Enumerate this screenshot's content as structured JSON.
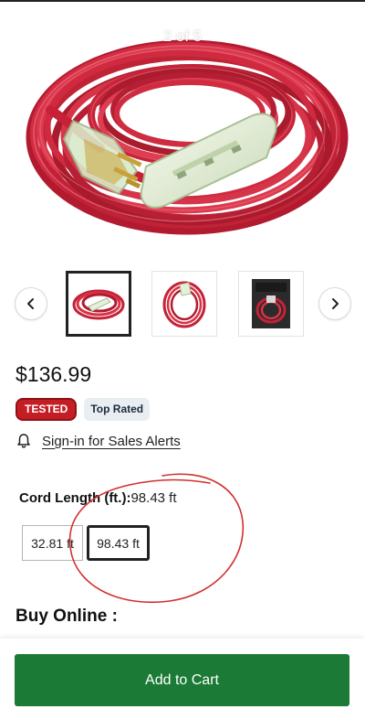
{
  "gallery": {
    "counter": "2 of 5",
    "main_image": "coiled-red-extension-cord-with-lighted-triple-outlet",
    "thumbnails": [
      {
        "name": "coiled-cord-thumbnail",
        "selected": true
      },
      {
        "name": "single-coil-thumbnail",
        "selected": false
      },
      {
        "name": "packaged-cord-thumbnail",
        "selected": false
      }
    ],
    "prev_icon": "chevron-left-icon",
    "next_icon": "chevron-right-icon"
  },
  "product": {
    "price": "$136.99",
    "badges": {
      "tested": "TESTED",
      "top_rated": "Top Rated"
    },
    "sales_alert_icon": "bell-icon",
    "sales_alert_link": "Sign-in for Sales Alerts"
  },
  "options": {
    "label": "Cord Length (ft.):",
    "selected_value": "98.43 ft",
    "choices": [
      {
        "label": "32.81 ft",
        "selected": false
      },
      {
        "label": "98.43 ft",
        "selected": true
      }
    ]
  },
  "purchase": {
    "section_title": "Buy Online :",
    "add_to_cart_label": "Add to Cart"
  },
  "colors": {
    "cord_red": "#c8283c",
    "tested_badge": "#c41e24",
    "top_rated_badge_bg": "#e9eef3",
    "cart_button": "#1b7a35",
    "annotation_circle": "#d32f2f"
  }
}
